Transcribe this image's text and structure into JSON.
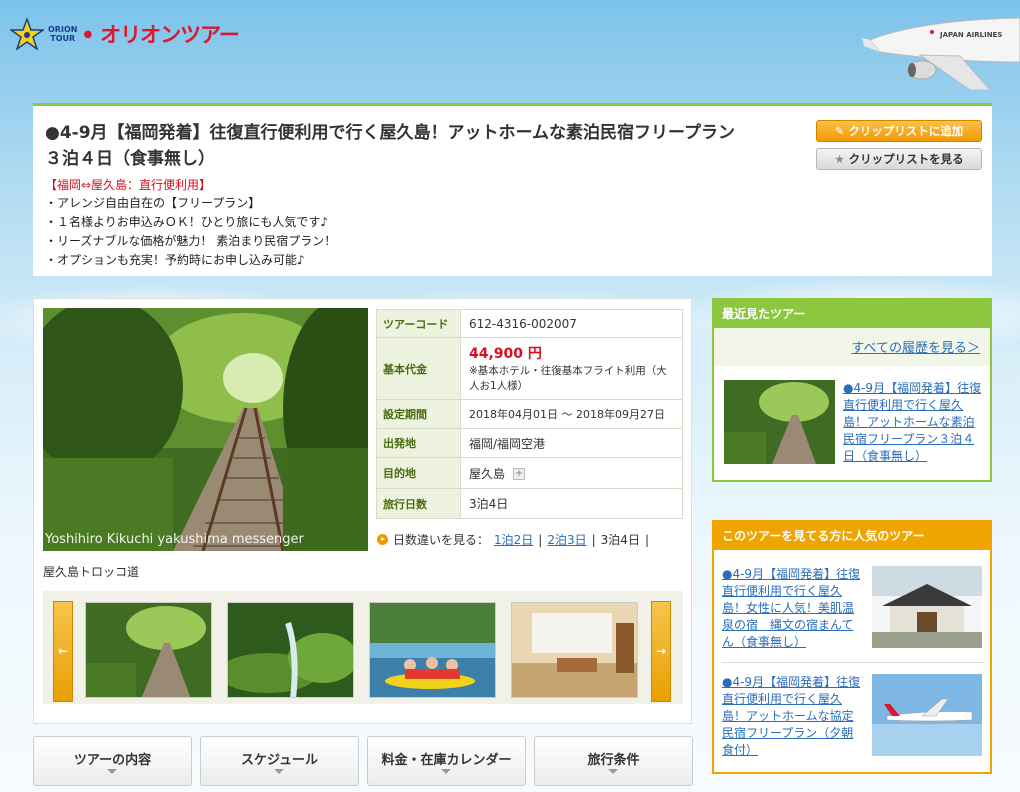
{
  "header": {
    "logo_badge": "ORION\nTOUR",
    "logo_text": "オリオンツアー",
    "airline_label": "JAPAN AIRLINES"
  },
  "title_panel": {
    "title_line1": "●4-9月【福岡発着】往復直行便利用で行く屋久島！アットホームな素泊民宿フリープラン",
    "title_line2": "３泊４日（食事無し）",
    "route": "【福岡⇔屋久島：直行便利用】",
    "features": [
      "・アレンジ自由自在の【フリープラン】",
      "・１名様よりお申込みＯＫ！ひとり旅にも人気です♪",
      "・リーズナブルな価格が魅力！ 素泊まり民宿プラン！",
      "・オプションも充実！予約時にお申し込み可能♪"
    ],
    "clip_add_label": "クリップリストに追加",
    "clip_view_label": "クリップリストを見る"
  },
  "main": {
    "photo_credit": "Yoshihiro Kikuchi  yakushima messenger",
    "photo_caption": "屋久島トロッコ道",
    "table": {
      "tour_code_label": "ツアーコード",
      "tour_code": "612-4316-002007",
      "price_label": "基本代金",
      "price": "44,900 円",
      "price_note": "※基本ホテル・往復基本フライト利用（大人お1人様）",
      "period_label": "設定期間",
      "period": "2018年04月01日 〜 2018年09月27日",
      "departure_label": "出発地",
      "departure": "福岡/福岡空港",
      "destination_label": "目的地",
      "destination": "屋久島",
      "duration_label": "旅行日数",
      "duration": "3泊4日"
    },
    "days": {
      "label": "日数違いを見る：",
      "opt1": "1泊2日",
      "opt2": "2泊3日",
      "current": "3泊4日",
      "sep": "|"
    },
    "prev_label": "←",
    "next_label": "→"
  },
  "tabs": [
    "ツアーの内容",
    "スケジュール",
    "料金・在庫カレンダー",
    "旅行条件"
  ],
  "sidebar": {
    "recent_header": "最近見たツアー",
    "recent_all_link": "すべての履歴を見る＞",
    "recent_item": "●4-9月【福岡発着】往復直行便利用で行く屋久島！アットホームな素泊民宿フリープラン３泊４日（食事無し）",
    "popular_header": "このツアーを見てる方に人気のツアー",
    "popular_items": [
      "●4-9月【福岡発着】往復直行便利用で行く屋久島！女性に人気！美肌温泉の宿　縄文の宿まんてん（食事無し）",
      "●4-9月【福岡発着】往復直行便利用で行く屋久島！アットホームな協定民宿フリープラン（夕朝食付）"
    ]
  },
  "colors": {
    "green_accent": "#8dc63f",
    "orange_accent": "#f0a400",
    "price_red": "#d4101f",
    "link_blue": "#2a6ebb"
  }
}
